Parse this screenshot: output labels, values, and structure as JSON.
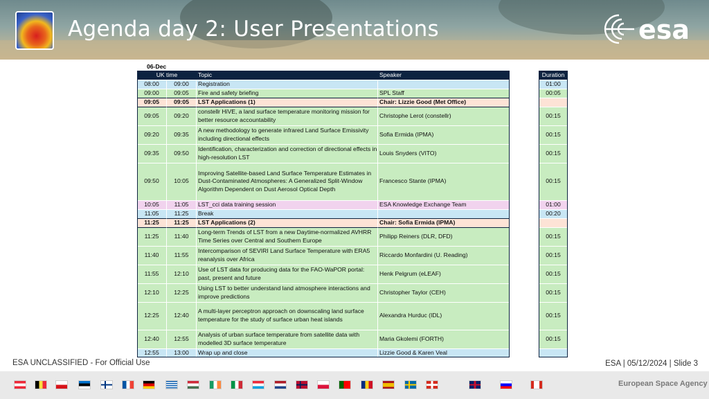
{
  "header": {
    "title": "Agenda day 2: User Presentations",
    "logo_text": "esa"
  },
  "schedule": {
    "date": "06-Dec",
    "headers": {
      "uk_time": "UK time",
      "topic": "Topic",
      "speaker": "Speaker",
      "duration": "Duration"
    },
    "rows": [
      {
        "start": "08:00",
        "end": "09:00",
        "topic": "Registration",
        "speaker": "",
        "duration": "01:00",
        "kind": "blue"
      },
      {
        "start": "09:00",
        "end": "09:05",
        "topic": "Fire and safety briefing",
        "speaker": "SPL Staff",
        "duration": "00:05",
        "kind": "green"
      },
      {
        "start": "09:05",
        "end": "09:05",
        "topic": "LST Applications (1)",
        "speaker": "Chair: Lizzie Good (Met Office)",
        "duration": "",
        "kind": "session"
      },
      {
        "start": "09:05",
        "end": "09:20",
        "topic": "constellr HiVE, a land surface temperature monitoring mission for better resource accountability",
        "speaker": "Christophe Lerot (constellr)",
        "duration": "00:15",
        "kind": "green"
      },
      {
        "start": "09:20",
        "end": "09:35",
        "topic": "A new methodology to generate infrared Land Surface Emissivity including directional effects",
        "speaker": "Sofia Ermida (IPMA)",
        "duration": "00:15",
        "kind": "green"
      },
      {
        "start": "09:35",
        "end": "09:50",
        "topic": "Identification, characterization and correction of directional effects in high-resolution LST",
        "speaker": "Louis Snyders (VITO)",
        "duration": "00:15",
        "kind": "green"
      },
      {
        "start": "09:50",
        "end": "10:05",
        "topic": "Improving Satellite-based Land Surface Temperature Estimates in Dust-Contaminated Atmospheres: A Generalized Split-Window Algorithm Dependent on Dust Aerosol Optical Depth",
        "speaker": "Francesco Stante (IPMA)",
        "duration": "00:15",
        "kind": "green"
      },
      {
        "start": "10:05",
        "end": "11:05",
        "topic": "LST_cci data training session",
        "speaker": "ESA Knowledge Exchange Team",
        "duration": "01:00",
        "kind": "pink"
      },
      {
        "start": "11:05",
        "end": "11:25",
        "topic": "Break",
        "speaker": "",
        "duration": "00:20",
        "kind": "blue"
      },
      {
        "start": "11:25",
        "end": "11:25",
        "topic": "LST Applications (2)",
        "speaker": "Chair: Sofia Ermida (IPMA)",
        "duration": "",
        "kind": "session"
      },
      {
        "start": "11:25",
        "end": "11:40",
        "topic": "Long-term Trends of LST from a new Daytime-normalized AVHRR Time Series over Central and Southern Europe",
        "speaker": "Philipp Reiners (DLR, DFD)",
        "duration": "00:15",
        "kind": "green"
      },
      {
        "start": "11:40",
        "end": "11:55",
        "topic": "Intercomparison of SEVIRI Land Surface Temperature with ERA5 reanalysis over Africa",
        "speaker": "Riccardo Monfardini (U. Reading)",
        "duration": "00:15",
        "kind": "green"
      },
      {
        "start": "11:55",
        "end": "12:10",
        "topic": "Use of LST data for producing data for the FAO-WaPOR portal: past, present and future",
        "speaker": "Henk Pelgrum (eLEAF)",
        "duration": "00:15",
        "kind": "green"
      },
      {
        "start": "12:10",
        "end": "12:25",
        "topic": "Using LST to better understand land atmosphere interactions and improve predictions",
        "speaker": "Christopher Taylor (CEH)",
        "duration": "00:15",
        "kind": "green"
      },
      {
        "start": "12:25",
        "end": "12:40",
        "topic": "A multi-layer perceptron approach on downscaling land surface temperature for the study of surface urban heat islands",
        "speaker": "Alexandra Hurduc (IDL)",
        "duration": "00:15",
        "kind": "green"
      },
      {
        "start": "12:40",
        "end": "12:55",
        "topic": "Analysis of urban surface temperature from satellite data with modelled 3D surface temperature",
        "speaker": "Maria Gkolemi (FORTH)",
        "duration": "00:15",
        "kind": "green"
      },
      {
        "start": "12:55",
        "end": "13:00",
        "topic": "Wrap up and close",
        "speaker": "Lizzie Good & Karen Veal",
        "duration": "",
        "kind": "blue"
      }
    ]
  },
  "footer": {
    "classification": "ESA UNCLASSIFIED - For Official Use",
    "slide_info": "ESA | 05/12/2024 | Slide  3",
    "agency": "European Space Agency"
  },
  "colors": {
    "header_row": "#0d2340",
    "blue_row": "#c8e6f4",
    "green_row": "#c8ecc0",
    "session_row": "#fde3d6",
    "pink_row": "#f1d3ee"
  },
  "flags": [
    "austria",
    "belgium",
    "czechia",
    "estonia",
    "finland",
    "france",
    "germany",
    "greece",
    "hungary",
    "ireland",
    "italy",
    "luxembourg",
    "netherlands",
    "norway",
    "poland",
    "portugal",
    "romania",
    "spain",
    "sweden",
    "switzerland",
    "united-kingdom",
    "slovenia",
    "canada"
  ]
}
